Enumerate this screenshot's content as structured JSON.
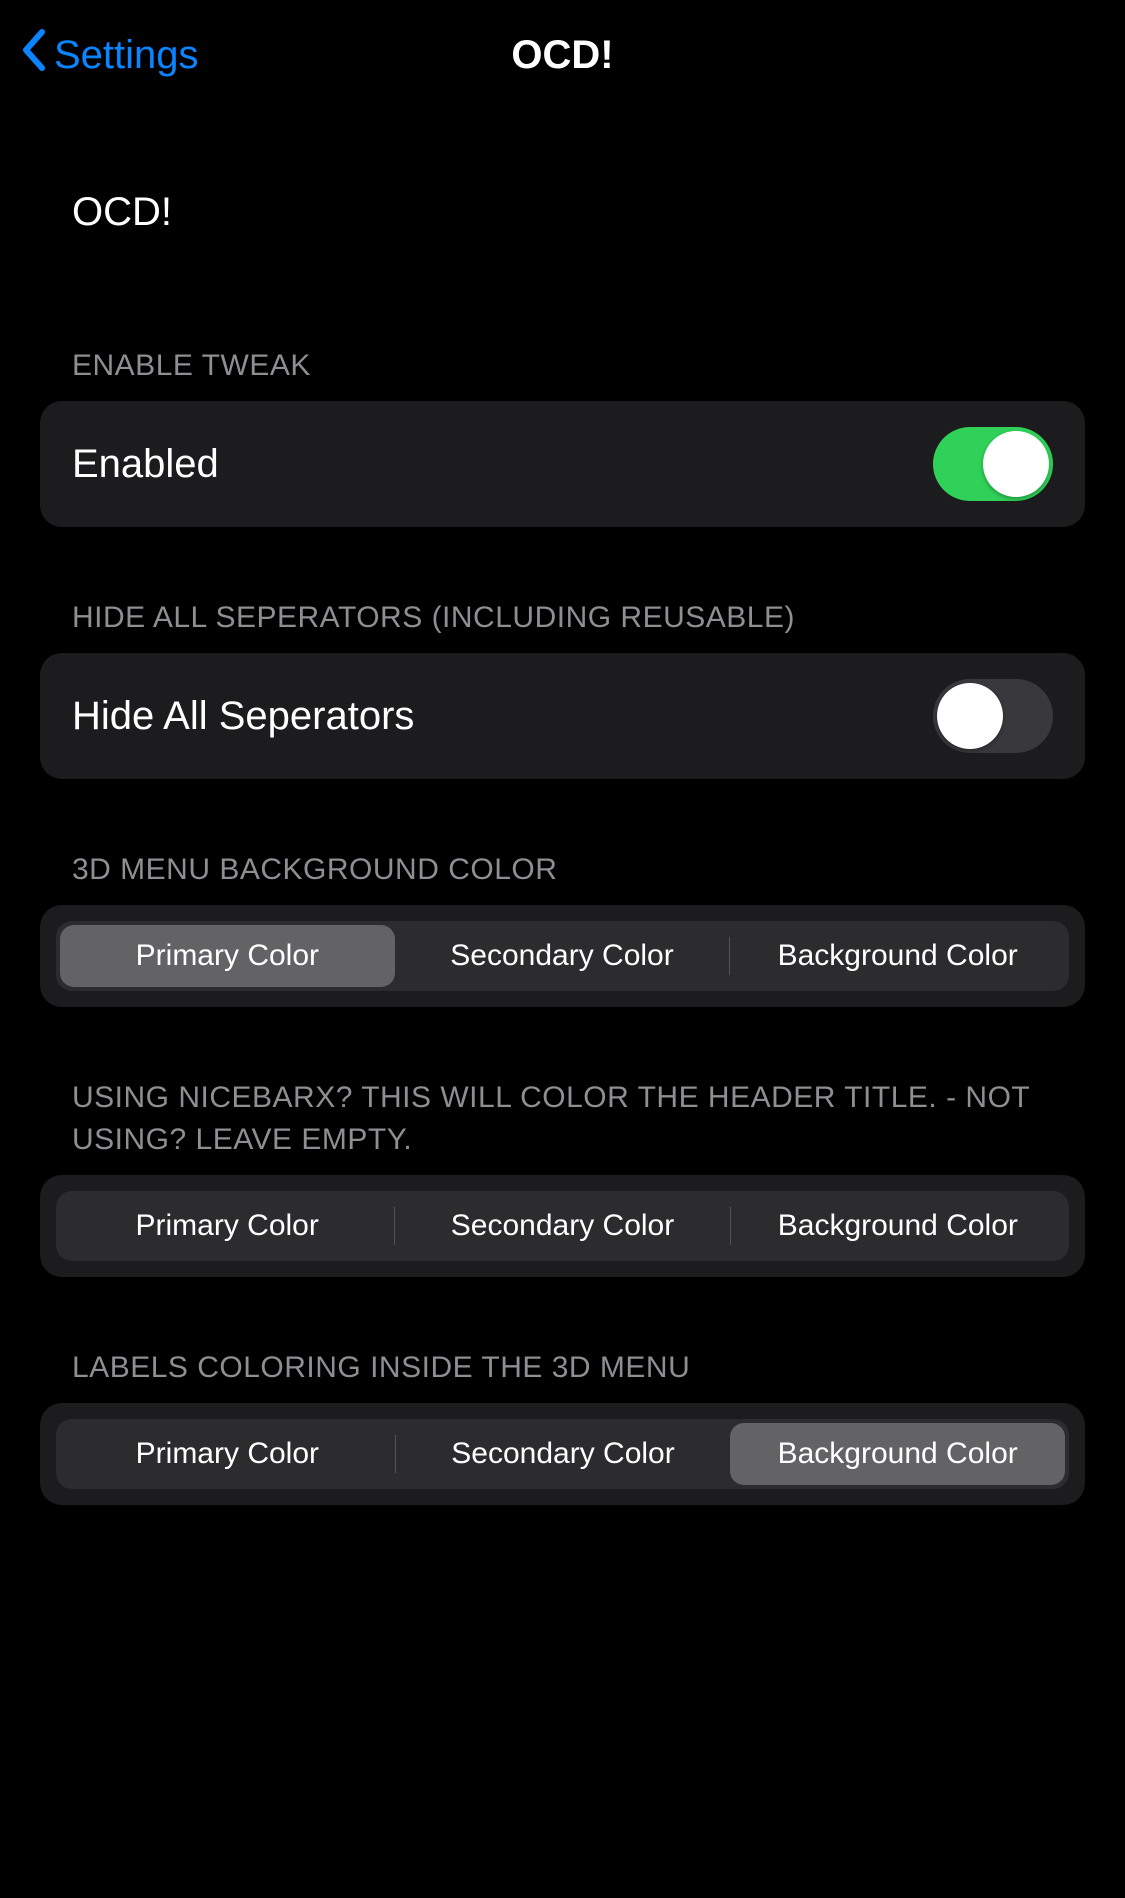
{
  "nav": {
    "back_label": "Settings",
    "title": "OCD!"
  },
  "section_intro": {
    "title": "OCD!"
  },
  "enable": {
    "header": "ENABLE TWEAK",
    "label": "Enabled",
    "on": true
  },
  "hide_sep": {
    "header": "HIDE ALL SEPERATORS (INCLUDING REUSABLE)",
    "label": "Hide All Seperators",
    "on": false
  },
  "menu_bg": {
    "header": "3D MENU BACKGROUND COLOR",
    "options": [
      "Primary Color",
      "Secondary Color",
      "Background Color"
    ],
    "selected": 0
  },
  "nicebarx": {
    "header": "USING NICEBARX? THIS WILL COLOR THE HEADER TITLE. - NOT USING? LEAVE EMPTY.",
    "options": [
      "Primary Color",
      "Secondary Color",
      "Background Color"
    ],
    "selected": -1
  },
  "labels_coloring": {
    "header": "LABELS COLORING INSIDE THE 3D MENU",
    "options": [
      "Primary Color",
      "Secondary Color",
      "Background Color"
    ],
    "selected": 2
  }
}
